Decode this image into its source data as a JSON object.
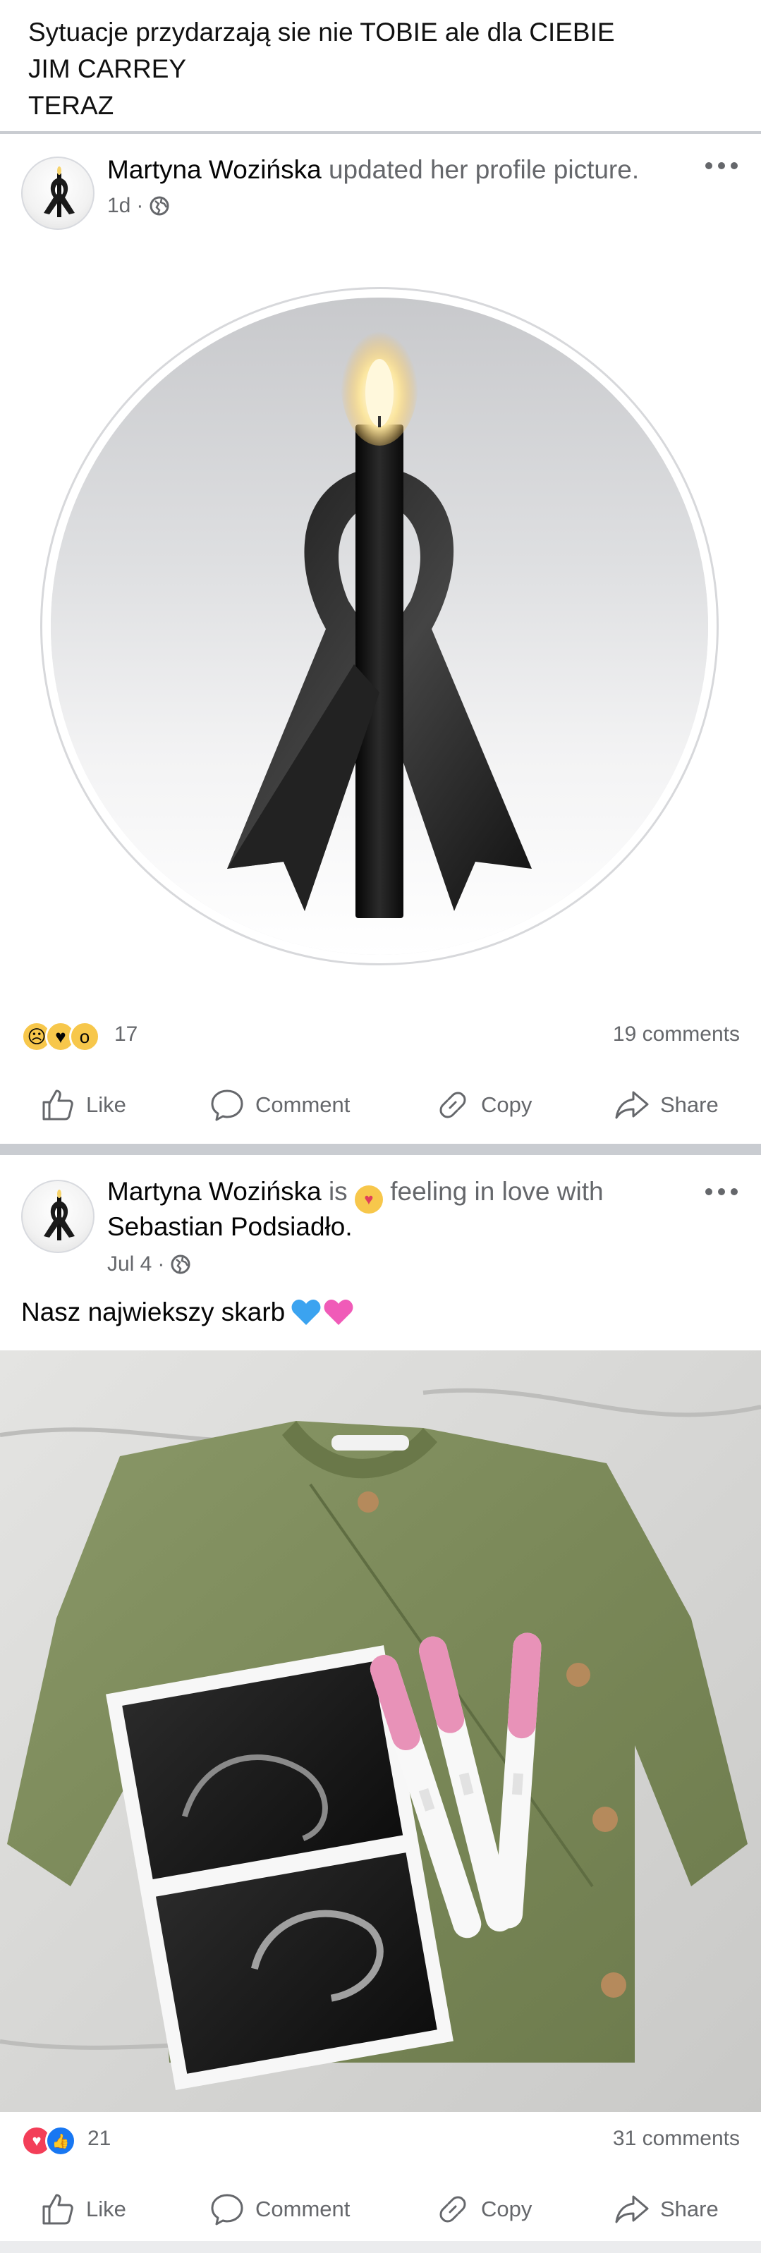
{
  "top_text": {
    "line1": "Sytuacje przydarzają sie nie TOBIE ale dla CIEBIE",
    "line2": "JIM CARREY",
    "line3": "TERAZ"
  },
  "post1": {
    "author": "Martyna Wozińska",
    "action": "updated her profile picture.",
    "time": "1d",
    "separator": "·",
    "privacy_icon": "globe-icon",
    "reaction_icons": [
      "sad-react-icon",
      "care-react-icon",
      "wow-react-icon"
    ],
    "reaction_count": "17",
    "comments": "19 comments",
    "actions": {
      "like": "Like",
      "comment": "Comment",
      "copy": "Copy",
      "share": "Share"
    }
  },
  "post2": {
    "author": "Martyna Wozińska",
    "is": "is",
    "feeling": "feeling in love with",
    "tagged": "Sebastian Podsiadło",
    "tagged_end": ".",
    "time": "Jul 4",
    "separator": "·",
    "privacy_icon": "globe-icon",
    "caption": "Nasz najwiekszy skarb",
    "caption_emojis": [
      "blue-heart-icon",
      "pink-heart-icon"
    ],
    "reaction_icons": [
      "love-react-icon",
      "like-react-icon"
    ],
    "reaction_count": "21",
    "comments": "31 comments",
    "actions": {
      "like": "Like",
      "comment": "Comment",
      "copy": "Copy",
      "share": "Share"
    }
  },
  "colors": {
    "muted": "#65676b",
    "divider": "#c9ccd1",
    "love": "#f33e58",
    "like": "#1877f2",
    "sweater": "#7c8a5e",
    "test_pink": "#ea8fb8"
  }
}
